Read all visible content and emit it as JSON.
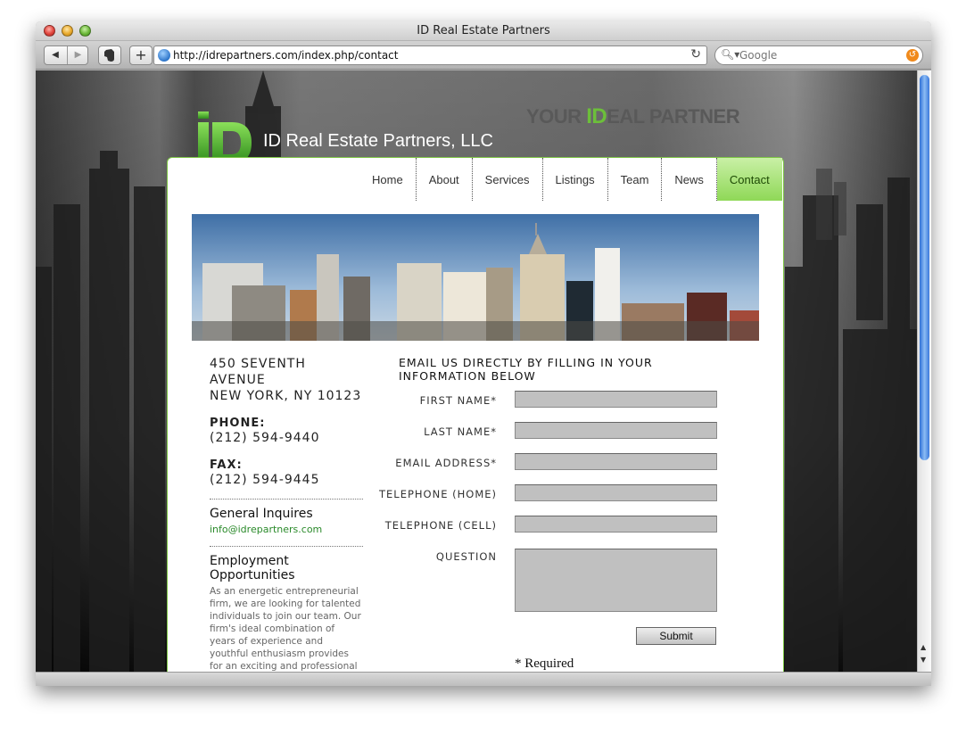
{
  "browser": {
    "window_title": "ID Real Estate Partners",
    "url": "http://idrepartners.com/index.php/contact",
    "search_placeholder": "Google"
  },
  "header": {
    "logo_letters": "iD",
    "site_name": "ID Real Estate Partners, LLC",
    "tagline_prefix": "YOUR ",
    "tagline_highlight": "ID",
    "tagline_suffix": "EAL PARTNER"
  },
  "nav": {
    "items": [
      {
        "label": "Home"
      },
      {
        "label": "About"
      },
      {
        "label": "Services"
      },
      {
        "label": "Listings"
      },
      {
        "label": "Team"
      },
      {
        "label": "News"
      },
      {
        "label": "Contact",
        "active": true
      }
    ]
  },
  "contact": {
    "address_line1": "450 SEVENTH AVENUE",
    "address_line2": "NEW YORK, NY 10123",
    "phone_label": "PHONE:",
    "phone": "(212) 594-9440",
    "fax_label": "FAX:",
    "fax": "(212) 594-9445",
    "general_heading": "General Inquires",
    "general_email": "info@idrepartners.com",
    "employment_heading": "Employment Opportunities",
    "employment_text": "As an energetic entrepreneurial firm, we are looking for talented individuals to join our team. Our firm's ideal combination of years of experience and youthful enthusiasm provides for an exciting and professional work environment. An ideal"
  },
  "form": {
    "title": "EMAIL US DIRECTLY BY FILLING IN YOUR INFORMATION BELOW",
    "first_name_label": "FIRST NAME*",
    "last_name_label": "LAST NAME*",
    "email_label": "EMAIL ADDRESS*",
    "tel_home_label": "TELEPHONE (HOME)",
    "tel_cell_label": "TELEPHONE (CELL)",
    "question_label": "QUESTION",
    "submit_label": "Submit",
    "required_note": "* Required"
  },
  "colors": {
    "accent_green": "#6cbf3a",
    "nav_active": "#8fd857",
    "panel_border": "#7cc443"
  }
}
